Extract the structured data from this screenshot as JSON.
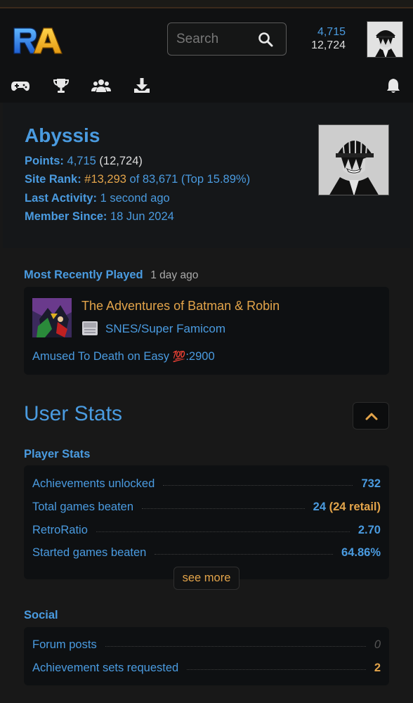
{
  "header": {
    "search_placeholder": "Search",
    "points": "4,715",
    "retro_points": "12,724"
  },
  "nav": {
    "icons": [
      "gamepad-icon",
      "trophy-icon",
      "users-icon",
      "download-icon",
      "bell-icon"
    ]
  },
  "profile": {
    "username": "Abyssis",
    "points_label": "Points:",
    "points_value": "4,715",
    "points_retro": "(12,724)",
    "rank_label": "Site Rank:",
    "rank_value": "#13,293",
    "rank_rest": "of 83,671 (Top 15.89%)",
    "activity_label": "Last Activity:",
    "activity_value": "1 second ago",
    "member_label": "Member Since:",
    "member_value": "18 Jun 2024"
  },
  "recent": {
    "label": "Most Recently Played",
    "time": "1 day ago",
    "game_title": "The Adventures of Batman & Robin",
    "console": "SNES/Super Famicom",
    "rich_presence": "Amused To Death on Easy ",
    "rich_presence_emoji": "💯",
    "rich_presence_score": ":2900"
  },
  "user_stats": {
    "title": "User Stats",
    "player_stats_label": "Player Stats",
    "rows": [
      {
        "label": "Achievements unlocked",
        "value": "732"
      },
      {
        "label": "Total games beaten",
        "value": "24",
        "extra": "(24 retail)"
      },
      {
        "label": "RetroRatio",
        "value": "2.70"
      },
      {
        "label": "Started games beaten",
        "value": "64.86%"
      }
    ],
    "see_more": "see more",
    "social_label": "Social",
    "social_rows": [
      {
        "label": "Forum posts",
        "value": "0"
      },
      {
        "label": "Achievement sets requested",
        "value": "2"
      }
    ]
  },
  "colors": {
    "accent_blue": "#4a9be0",
    "accent_gold": "#e3a44a",
    "background": "#181818"
  }
}
